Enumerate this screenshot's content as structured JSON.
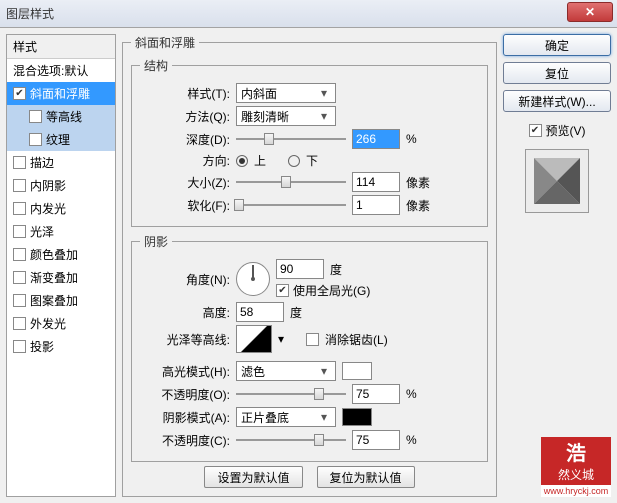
{
  "window": {
    "title": "图层样式",
    "close": "✕"
  },
  "left": {
    "header": "样式",
    "blend": "混合选项:默认",
    "items": [
      {
        "label": "斜面和浮雕",
        "checked": true,
        "selected": true
      },
      {
        "label": "等高线",
        "checked": false,
        "sub": true,
        "sel2": true
      },
      {
        "label": "纹理",
        "checked": false,
        "sub": true,
        "sel2": true
      },
      {
        "label": "描边",
        "checked": false
      },
      {
        "label": "内阴影",
        "checked": false
      },
      {
        "label": "内发光",
        "checked": false
      },
      {
        "label": "光泽",
        "checked": false
      },
      {
        "label": "颜色叠加",
        "checked": false
      },
      {
        "label": "渐变叠加",
        "checked": false
      },
      {
        "label": "图案叠加",
        "checked": false
      },
      {
        "label": "外发光",
        "checked": false
      },
      {
        "label": "投影",
        "checked": false
      }
    ]
  },
  "center": {
    "main_legend": "斜面和浮雕",
    "structure_legend": "结构",
    "style_lbl": "样式(T):",
    "style_val": "内斜面",
    "method_lbl": "方法(Q):",
    "method_val": "雕刻清晰",
    "depth_lbl": "深度(D):",
    "depth_val": "266",
    "depth_unit": "%",
    "direction_lbl": "方向:",
    "dir_up": "上",
    "dir_down": "下",
    "size_lbl": "大小(Z):",
    "size_val": "114",
    "size_unit": "像素",
    "soften_lbl": "软化(F):",
    "soften_val": "1",
    "soften_unit": "像素",
    "shading_legend": "阴影",
    "angle_lbl": "角度(N):",
    "angle_val": "90",
    "angle_unit": "度",
    "global_label": "使用全局光(G)",
    "alt_lbl": "高度:",
    "alt_val": "58",
    "alt_unit": "度",
    "gloss_lbl": "光泽等高线:",
    "antialias": "消除锯齿(L)",
    "hl_mode_lbl": "高光模式(H):",
    "hl_mode_val": "滤色",
    "hl_op_lbl": "不透明度(O):",
    "hl_op_val": "75",
    "hl_op_unit": "%",
    "sh_mode_lbl": "阴影模式(A):",
    "sh_mode_val": "正片叠底",
    "sh_op_lbl": "不透明度(C):",
    "sh_op_val": "75",
    "sh_op_unit": "%",
    "set_default": "设置为默认值",
    "reset_default": "复位为默认值"
  },
  "right": {
    "ok": "确定",
    "cancel": "复位",
    "new_style": "新建样式(W)...",
    "preview_label": "预览(V)"
  },
  "colors": {
    "hl": "#ffffff",
    "sh": "#000000"
  },
  "wm": {
    "line1": "浩",
    "line2": "然义城",
    "url": "www.hryckj.com"
  }
}
